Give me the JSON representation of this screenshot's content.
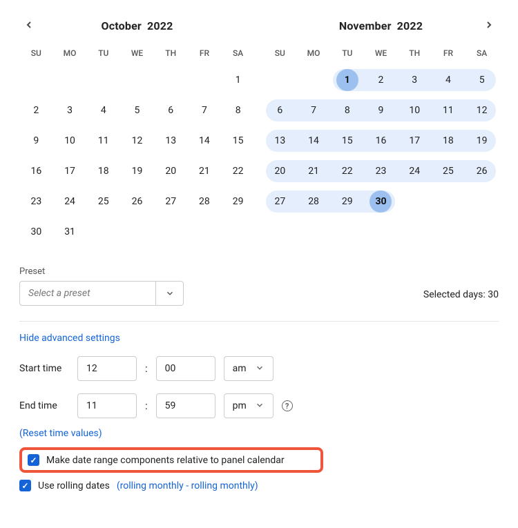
{
  "dow": [
    "SU",
    "MO",
    "TU",
    "WE",
    "TH",
    "FR",
    "SA"
  ],
  "months": [
    {
      "title_month": "October",
      "title_year": "2022",
      "nav_prev": true,
      "nav_next": false,
      "weeks": [
        [
          null,
          null,
          null,
          null,
          null,
          null,
          {
            "d": 1
          }
        ],
        [
          {
            "d": 2
          },
          {
            "d": 3
          },
          {
            "d": 4
          },
          {
            "d": 5
          },
          {
            "d": 6
          },
          {
            "d": 7
          },
          {
            "d": 8
          }
        ],
        [
          {
            "d": 9
          },
          {
            "d": 10
          },
          {
            "d": 11
          },
          {
            "d": 12
          },
          {
            "d": 13
          },
          {
            "d": 14
          },
          {
            "d": 15
          }
        ],
        [
          {
            "d": 16
          },
          {
            "d": 17
          },
          {
            "d": 18
          },
          {
            "d": 19
          },
          {
            "d": 20
          },
          {
            "d": 21
          },
          {
            "d": 22
          }
        ],
        [
          {
            "d": 23
          },
          {
            "d": 24
          },
          {
            "d": 25
          },
          {
            "d": 26
          },
          {
            "d": 27
          },
          {
            "d": 28
          },
          {
            "d": 29
          }
        ],
        [
          {
            "d": 30
          },
          {
            "d": 31
          },
          null,
          null,
          null,
          null,
          null
        ]
      ]
    },
    {
      "title_month": "November",
      "title_year": "2022",
      "nav_prev": false,
      "nav_next": true,
      "weeks": [
        [
          null,
          null,
          {
            "d": 1,
            "sel": true,
            "start": true,
            "endpoint": true
          },
          {
            "d": 2,
            "sel": true
          },
          {
            "d": 3,
            "sel": true
          },
          {
            "d": 4,
            "sel": true
          },
          {
            "d": 5,
            "sel": true,
            "end": true
          }
        ],
        [
          {
            "d": 6,
            "sel": true,
            "start": true
          },
          {
            "d": 7,
            "sel": true
          },
          {
            "d": 8,
            "sel": true
          },
          {
            "d": 9,
            "sel": true
          },
          {
            "d": 10,
            "sel": true
          },
          {
            "d": 11,
            "sel": true
          },
          {
            "d": 12,
            "sel": true,
            "end": true
          }
        ],
        [
          {
            "d": 13,
            "sel": true,
            "start": true
          },
          {
            "d": 14,
            "sel": true
          },
          {
            "d": 15,
            "sel": true
          },
          {
            "d": 16,
            "sel": true
          },
          {
            "d": 17,
            "sel": true
          },
          {
            "d": 18,
            "sel": true
          },
          {
            "d": 19,
            "sel": true,
            "end": true
          }
        ],
        [
          {
            "d": 20,
            "sel": true,
            "start": true
          },
          {
            "d": 21,
            "sel": true
          },
          {
            "d": 22,
            "sel": true
          },
          {
            "d": 23,
            "sel": true
          },
          {
            "d": 24,
            "sel": true
          },
          {
            "d": 25,
            "sel": true
          },
          {
            "d": 26,
            "sel": true,
            "end": true
          }
        ],
        [
          {
            "d": 27,
            "sel": true,
            "start": true
          },
          {
            "d": 28,
            "sel": true
          },
          {
            "d": 29,
            "sel": true
          },
          {
            "d": 30,
            "sel": true,
            "end": true,
            "endpoint": true
          },
          null,
          null,
          null
        ]
      ]
    }
  ],
  "preset": {
    "label": "Preset",
    "placeholder": "Select a preset"
  },
  "selected_days_label": "Selected days: 30",
  "advanced_toggle": "Hide advanced settings",
  "time": {
    "start_label": "Start time",
    "end_label": "End time",
    "start_hour": "12",
    "start_min": "00",
    "start_ampm": "am",
    "end_hour": "11",
    "end_min": "59",
    "end_ampm": "pm",
    "reset_label": "(Reset time values)"
  },
  "options": {
    "relative_label": "Make date range components relative to panel calendar",
    "rolling_label": "Use rolling dates",
    "rolling_detail": "(rolling monthly - rolling monthly)"
  }
}
